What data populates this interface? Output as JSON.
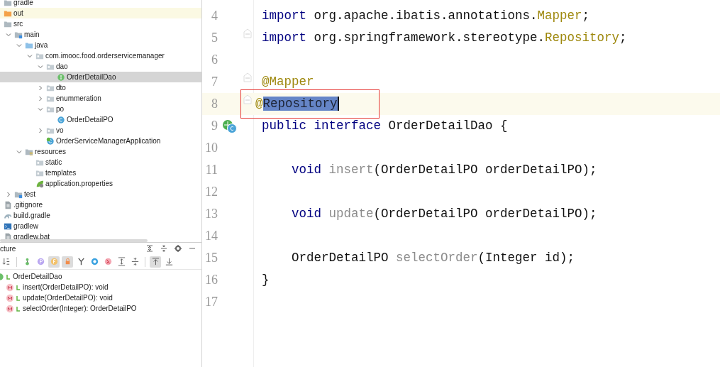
{
  "project_tree": [
    {
      "label": "gradle",
      "kind": "folder"
    },
    {
      "label": "out",
      "kind": "excluded",
      "highlighted": true
    },
    {
      "label": "src",
      "kind": "folder",
      "children": [
        {
          "label": "main",
          "kind": "root",
          "expanded": true,
          "children": [
            {
              "label": "java",
              "kind": "sources",
              "expanded": true,
              "children": [
                {
                  "label": "com.imooc.food.orderservicemanager",
                  "kind": "package",
                  "expanded": true,
                  "children": [
                    {
                      "label": "dao",
                      "kind": "package",
                      "expanded": true,
                      "children": [
                        {
                          "label": "OrderDetailDao",
                          "kind": "interface",
                          "selected": true
                        }
                      ]
                    },
                    {
                      "label": "dto",
                      "kind": "package",
                      "expanded": false
                    },
                    {
                      "label": "enummeration",
                      "kind": "package",
                      "expanded": false
                    },
                    {
                      "label": "po",
                      "kind": "package",
                      "expanded": true,
                      "children": [
                        {
                          "label": "OrderDetailPO",
                          "kind": "class",
                          "selected": false
                        }
                      ]
                    },
                    {
                      "label": "vo",
                      "kind": "package",
                      "expanded": false
                    },
                    {
                      "label": "OrderServiceManagerApplication",
                      "kind": "application",
                      "selected": false
                    }
                  ]
                }
              ]
            },
            {
              "label": "resources",
              "kind": "resources",
              "expanded": true,
              "children": [
                {
                  "label": "static",
                  "kind": "package"
                },
                {
                  "label": "templates",
                  "kind": "package"
                },
                {
                  "label": "application.properties",
                  "kind": "properties"
                }
              ]
            }
          ]
        },
        {
          "label": "test",
          "kind": "root",
          "expanded": false
        }
      ]
    },
    {
      "label": ".gitignore",
      "kind": "file"
    },
    {
      "label": "build.gradle",
      "kind": "gradle"
    },
    {
      "label": "gradlew",
      "kind": "terminal"
    },
    {
      "label": "gradlew.bat",
      "kind": "file"
    }
  ],
  "structure": {
    "title": "cture",
    "toolbar": [
      {
        "kind": "sort",
        "on": false
      },
      {
        "kind": "separator"
      },
      {
        "kind": "inherited",
        "on": false
      },
      {
        "kind": "property",
        "on": false
      },
      {
        "kind": "field",
        "on": true
      },
      {
        "kind": "lock",
        "on": true
      },
      {
        "kind": "branch",
        "on": false
      },
      {
        "kind": "circle",
        "on": false
      },
      {
        "kind": "lambda",
        "on": false
      },
      {
        "kind": "expand",
        "on": false
      },
      {
        "kind": "collapse",
        "on": false
      },
      {
        "kind": "separator"
      },
      {
        "kind": "up",
        "on": true
      },
      {
        "kind": "down",
        "on": false
      }
    ],
    "items": [
      {
        "label": "OrderDetailDao",
        "kind": "interface",
        "children": [
          {
            "label": "insert(OrderDetailPO): void",
            "kind": "method"
          },
          {
            "label": "update(OrderDetailPO): void",
            "kind": "method"
          },
          {
            "label": "selectOrder(Integer): OrderDetailPO",
            "kind": "method"
          }
        ]
      }
    ]
  },
  "editor": {
    "lines": [
      {
        "number": "4",
        "tokens": [
          {
            "text": "import",
            "kind": "keyword"
          },
          {
            "text": " org.apache.ibatis.annotations.",
            "kind": "plain"
          },
          {
            "text": "Mapper",
            "kind": "annotation"
          },
          {
            "text": ";",
            "kind": "plain"
          }
        ]
      },
      {
        "number": "5",
        "fold": true,
        "tokens": [
          {
            "text": "import",
            "kind": "keyword"
          },
          {
            "text": " org.springframework.stereotype.",
            "kind": "plain"
          },
          {
            "text": "Repository",
            "kind": "annotation"
          },
          {
            "text": ";",
            "kind": "plain"
          }
        ]
      },
      {
        "number": "6"
      },
      {
        "number": "7",
        "fold": true,
        "tokens": [
          {
            "text": "@Mapper",
            "kind": "annotation"
          }
        ]
      },
      {
        "number": "8",
        "fold": true,
        "current": true,
        "boxed": true,
        "tokens": [
          {
            "text": "@",
            "kind": "annotation"
          },
          {
            "text": "Repository",
            "kind": "selected"
          }
        ]
      },
      {
        "number": "9",
        "implemented": true,
        "tokens": [
          {
            "text": "public interface",
            "kind": "keyword"
          },
          {
            "text": " OrderDetailDao {",
            "kind": "plain"
          }
        ]
      },
      {
        "number": "10"
      },
      {
        "number": "11",
        "tokens": [
          {
            "text": "    void ",
            "kind": "keyword"
          },
          {
            "text": "insert",
            "kind": "unused"
          },
          {
            "text": "(OrderDetailPO orderDetailPO);",
            "kind": "plain"
          }
        ]
      },
      {
        "number": "12"
      },
      {
        "number": "13",
        "tokens": [
          {
            "text": "    void ",
            "kind": "keyword"
          },
          {
            "text": "update",
            "kind": "unused"
          },
          {
            "text": "(OrderDetailPO orderDetailPO);",
            "kind": "plain"
          }
        ]
      },
      {
        "number": "14"
      },
      {
        "number": "15",
        "tokens": [
          {
            "text": "    OrderDetailPO ",
            "kind": "plain"
          },
          {
            "text": "selectOrder",
            "kind": "unused"
          },
          {
            "text": "(Integer id);",
            "kind": "plain"
          }
        ]
      },
      {
        "number": "16",
        "tokens": [
          {
            "text": "}",
            "kind": "plain"
          }
        ]
      },
      {
        "number": "17"
      }
    ]
  }
}
